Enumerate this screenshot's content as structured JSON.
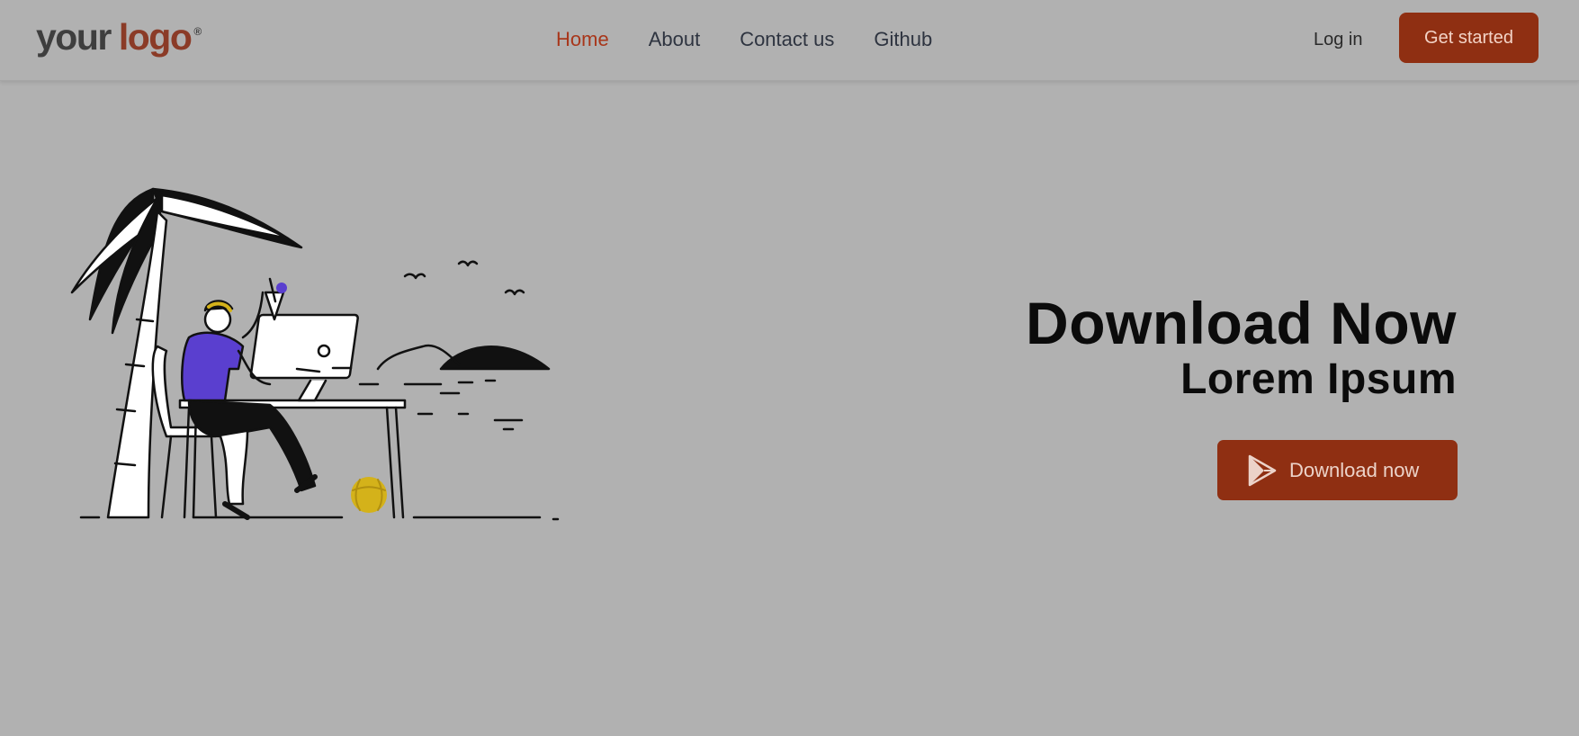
{
  "navbar": {
    "logo": {
      "part1": "your",
      "part2": "logo",
      "reg": "®"
    },
    "links": [
      {
        "label": "Home",
        "active": true
      },
      {
        "label": "About",
        "active": false
      },
      {
        "label": "Contact us",
        "active": false
      },
      {
        "label": "Github",
        "active": false
      }
    ],
    "login_label": "Log in",
    "cta_label": "Get started"
  },
  "hero": {
    "title": "Download Now",
    "subtitle": "Lorem Ipsum",
    "button_label": "Download now",
    "button_icon": "play-store-icon",
    "illustration": "person-working-at-desk-under-palm-tree"
  },
  "colors": {
    "background": "#b1b1b1",
    "accent": "#8f2f12",
    "active_link": "#a8361a",
    "shirt": "#5a3fcf",
    "ball": "#d4b21a"
  }
}
